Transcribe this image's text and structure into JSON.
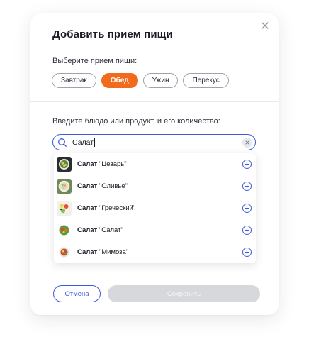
{
  "modal": {
    "title": "Добавить прием пищи",
    "meal_prompt": "Выберите прием пищи:",
    "meals": [
      {
        "label": "Завтрак",
        "selected": false
      },
      {
        "label": "Обед",
        "selected": true
      },
      {
        "label": "Ужин",
        "selected": false
      },
      {
        "label": "Перекус",
        "selected": false
      }
    ],
    "dish_prompt": "Введите блюдо или продукт, и его количество:",
    "search": {
      "value": "Салат",
      "icon": "search-icon"
    },
    "suggestions": [
      {
        "bold": "Салат",
        "rest": " \"Цезарь\"",
        "icon": "caesar-salad-thumbnail"
      },
      {
        "bold": "Салат",
        "rest": " \"Оливье\"",
        "icon": "olivier-salad-thumbnail"
      },
      {
        "bold": "Салат",
        "rest": " \"Греческий\"",
        "icon": "greek-salad-thumbnail"
      },
      {
        "bold": "Салат",
        "rest": " \"Салат\"",
        "icon": "salad-thumbnail"
      },
      {
        "bold": "Салат",
        "rest": " \"Мимоза\"",
        "icon": "mimosa-salad-thumbnail"
      }
    ],
    "buttons": {
      "cancel": "Отмена",
      "save": "Сохранить"
    }
  },
  "colors": {
    "accent": "#3d5bd9",
    "selected_chip": "#f26a1b",
    "disabled": "#d6d8dc"
  }
}
